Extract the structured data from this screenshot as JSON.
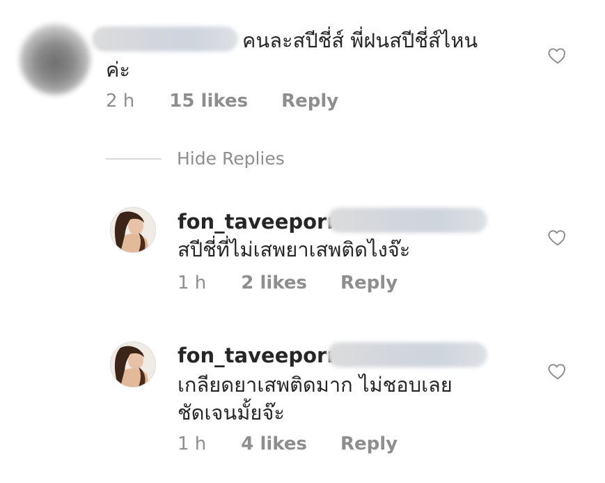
{
  "comments": [
    {
      "text_line1": "คนละสปีชี่ส์ พี่ฝนสปีชี่ส์ไหน",
      "text_line2": "ค่ะ",
      "time": "2 h",
      "likes": "15 likes",
      "reply": "Reply"
    }
  ],
  "hide_replies": "Hide Replies",
  "replies": [
    {
      "username": "fon_taveeporn",
      "text_line1": "สปีชี่ที่ไม่เสพยาเสพติดไงจ๊ะ",
      "time": "1 h",
      "likes": "2 likes",
      "reply": "Reply"
    },
    {
      "username": "fon_taveeporn",
      "text_line1": "เกลียดยาเสพติดมาก ไม่ชอบเลย",
      "text_line2": "ชัดเจนมั้ยจ๊ะ",
      "time": "1 h",
      "likes": "4 likes",
      "reply": "Reply"
    }
  ],
  "icons": {
    "like": "heart-outline-icon"
  },
  "colors": {
    "text": "#262626",
    "muted": "#8e8e8e",
    "divider": "#dbdbdb"
  }
}
